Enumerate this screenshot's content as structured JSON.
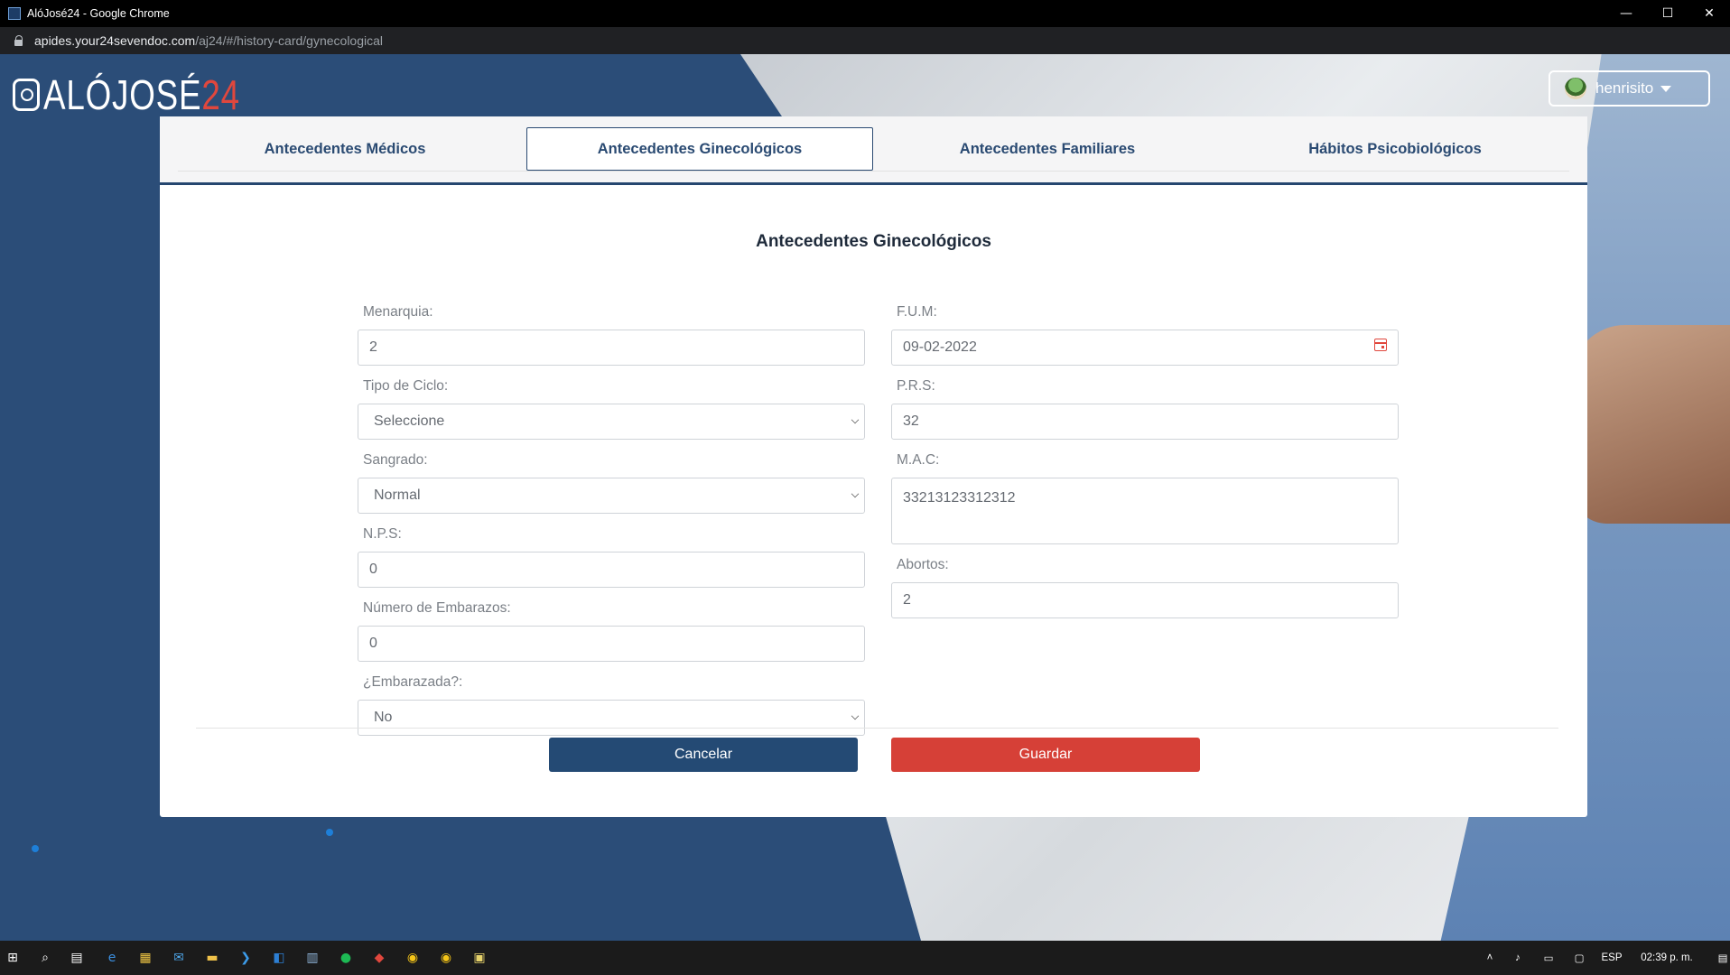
{
  "browser": {
    "window_title": "AlóJosé24 - Google Chrome",
    "url_host": "apides.your24sevendoc.com",
    "url_path": "/aj24/#/history-card/gynecological",
    "minimize_glyph": "—",
    "maximize_glyph": "☐",
    "close_glyph": "✕"
  },
  "header": {
    "logo_main": "ALÓJOSÉ",
    "logo_accent": "24",
    "user_name": "henrisito"
  },
  "tabs": [
    {
      "label": "Antecedentes Médicos",
      "active": false
    },
    {
      "label": "Antecedentes Ginecológicos",
      "active": true
    },
    {
      "label": "Antecedentes Familiares",
      "active": false
    },
    {
      "label": "Hábitos Psicobiológicos",
      "active": false
    }
  ],
  "form": {
    "title": "Antecedentes Ginecológicos",
    "left": [
      {
        "label": "Menarquia:",
        "value": "2",
        "type": "input"
      },
      {
        "label": "Tipo de Ciclo:",
        "value": "Seleccione",
        "type": "select"
      },
      {
        "label": "Sangrado:",
        "value": "Normal",
        "type": "select"
      },
      {
        "label": "N.P.S:",
        "value": "0",
        "type": "input"
      },
      {
        "label": "Número de Embarazos:",
        "value": "0",
        "type": "input"
      },
      {
        "label": "¿Embarazada?:",
        "value": "No",
        "type": "select"
      }
    ],
    "right": [
      {
        "label": "F.U.M:",
        "value": "09-02-2022",
        "type": "date"
      },
      {
        "label": "P.R.S:",
        "value": "32",
        "type": "input"
      },
      {
        "label": "M.A.C:",
        "value": "33213123312312",
        "type": "textarea"
      },
      {
        "label": "Abortos:",
        "value": "2",
        "type": "input"
      }
    ],
    "cancel_label": "Cancelar",
    "save_label": "Guardar"
  },
  "colors": {
    "primary": "#244a74",
    "danger": "#d64037",
    "accent_red": "#e0473d"
  },
  "taskbar": {
    "language": "ESP",
    "clock": "02:39 p. m."
  }
}
